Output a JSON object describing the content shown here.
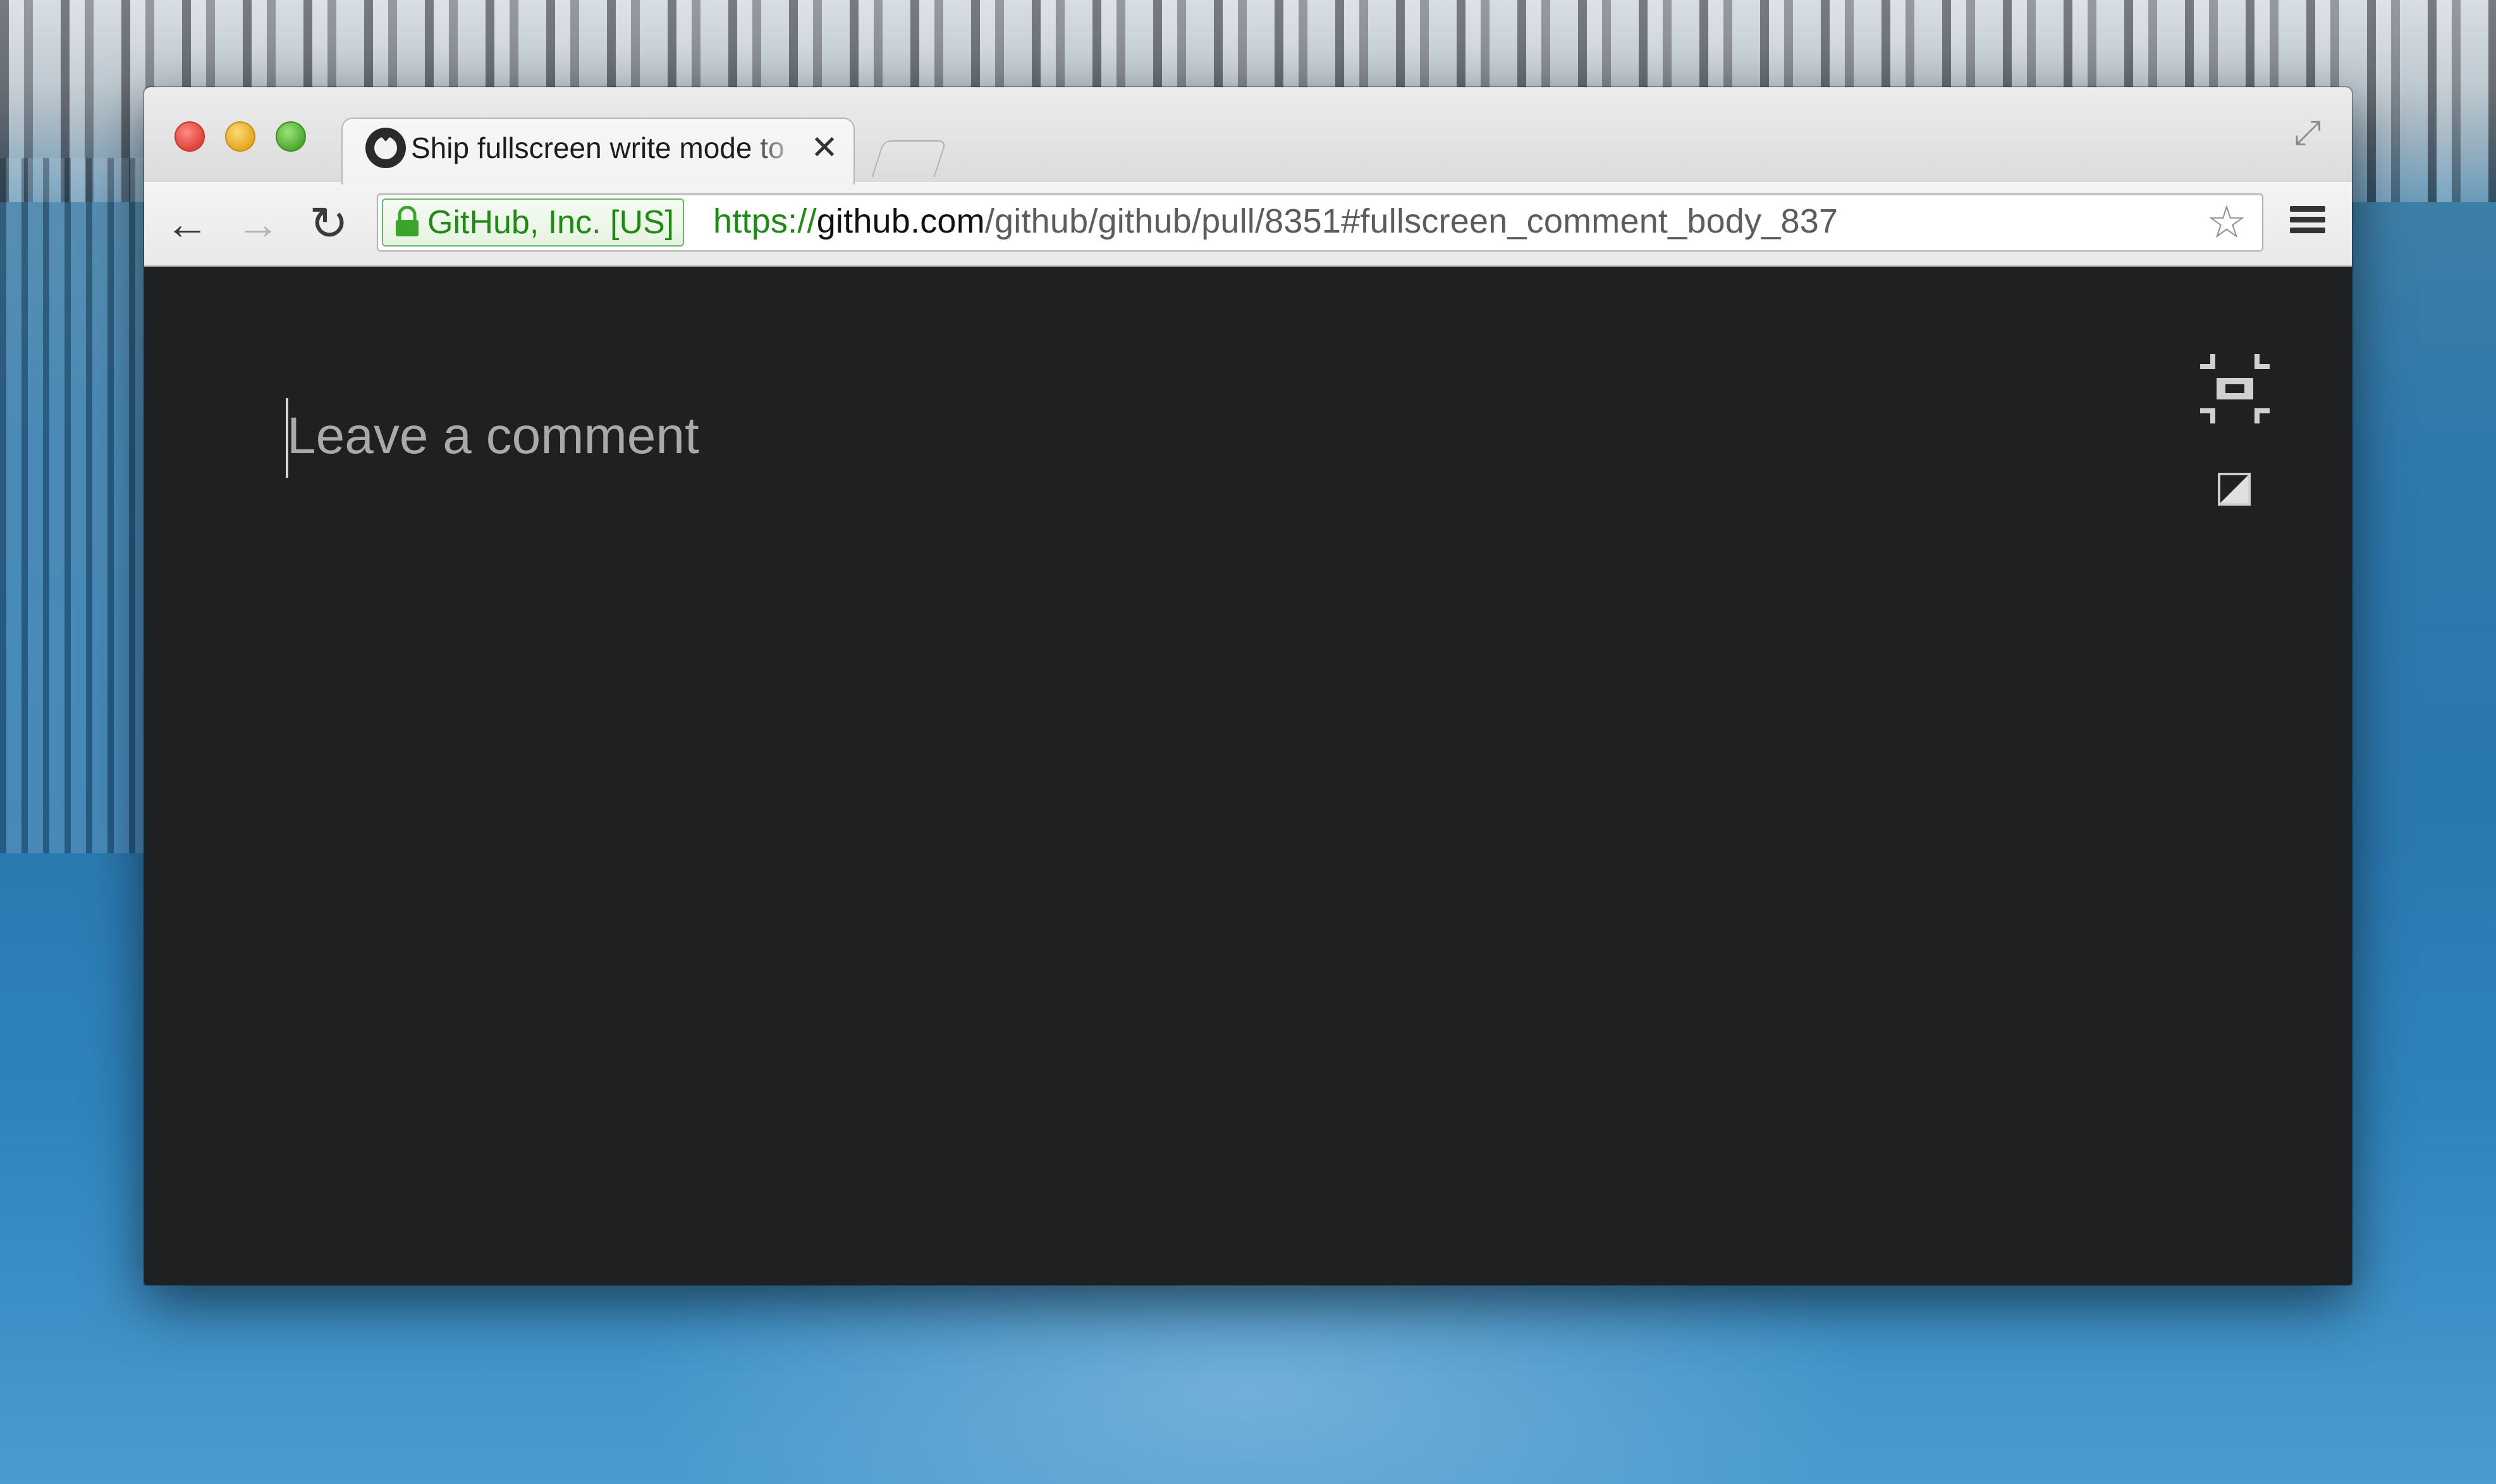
{
  "browser": {
    "tab": {
      "title": "Ship fullscreen write mode to",
      "close_glyph": "✕",
      "favicon": "github-octocat-icon"
    },
    "toolbar": {
      "back_glyph": "←",
      "forward_glyph": "→",
      "reload_glyph": "↻",
      "ev_label": "GitHub, Inc. [US]",
      "url": {
        "scheme": "https://",
        "host": "github.com",
        "path": "/github/github/pull/8351#fullscreen_comment_body_837"
      },
      "star_glyph": "☆"
    },
    "fullscreen_glyph": "⤢",
    "colors": {
      "ev_green": "#1f8a13",
      "content_bg": "#1f2022"
    }
  },
  "editor": {
    "placeholder": "Leave a comment",
    "value": ""
  }
}
